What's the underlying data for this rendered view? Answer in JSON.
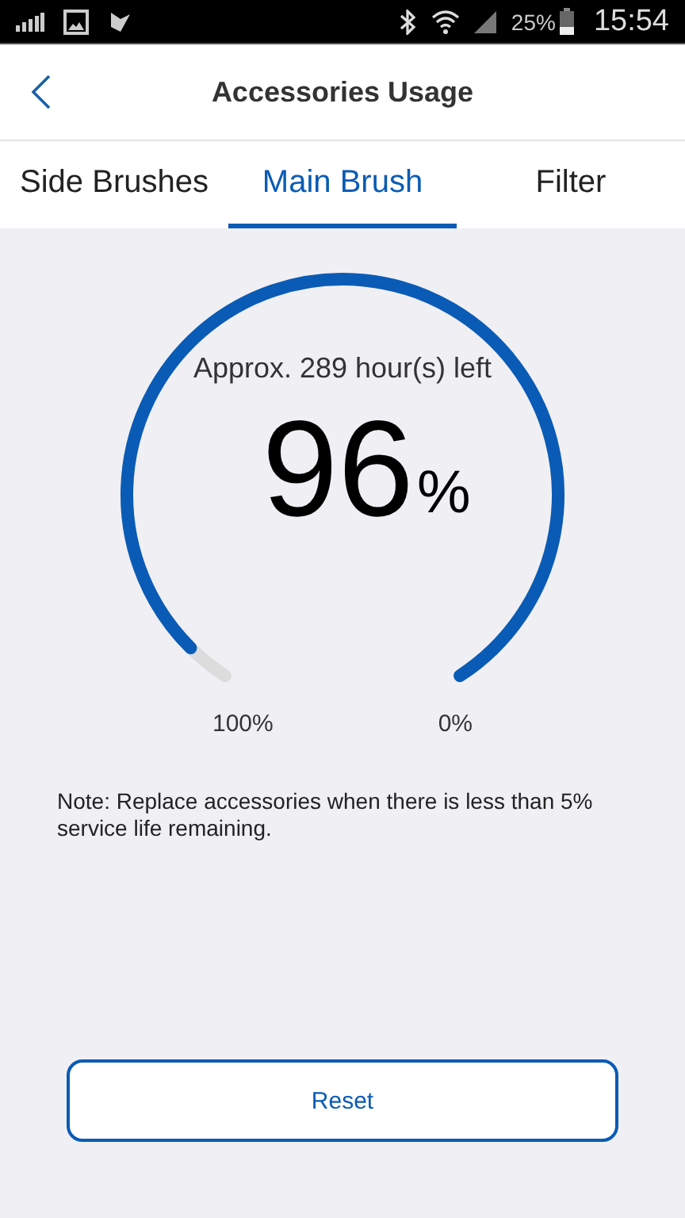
{
  "status_bar": {
    "battery": "25%",
    "time": "15:54"
  },
  "header": {
    "title": "Accessories Usage"
  },
  "tabs": [
    {
      "label": "Side Brushes",
      "selected": false
    },
    {
      "label": "Main Brush",
      "selected": true
    },
    {
      "label": "Filter",
      "selected": false
    }
  ],
  "gauge": {
    "remaining": "Approx. 289 hour(s) left",
    "value": "96",
    "unit": "%",
    "start_label": "100%",
    "end_label": "0%"
  },
  "note": "Note: Replace accessories when there is less than 5% service life remaining.",
  "reset_button": "Reset"
}
